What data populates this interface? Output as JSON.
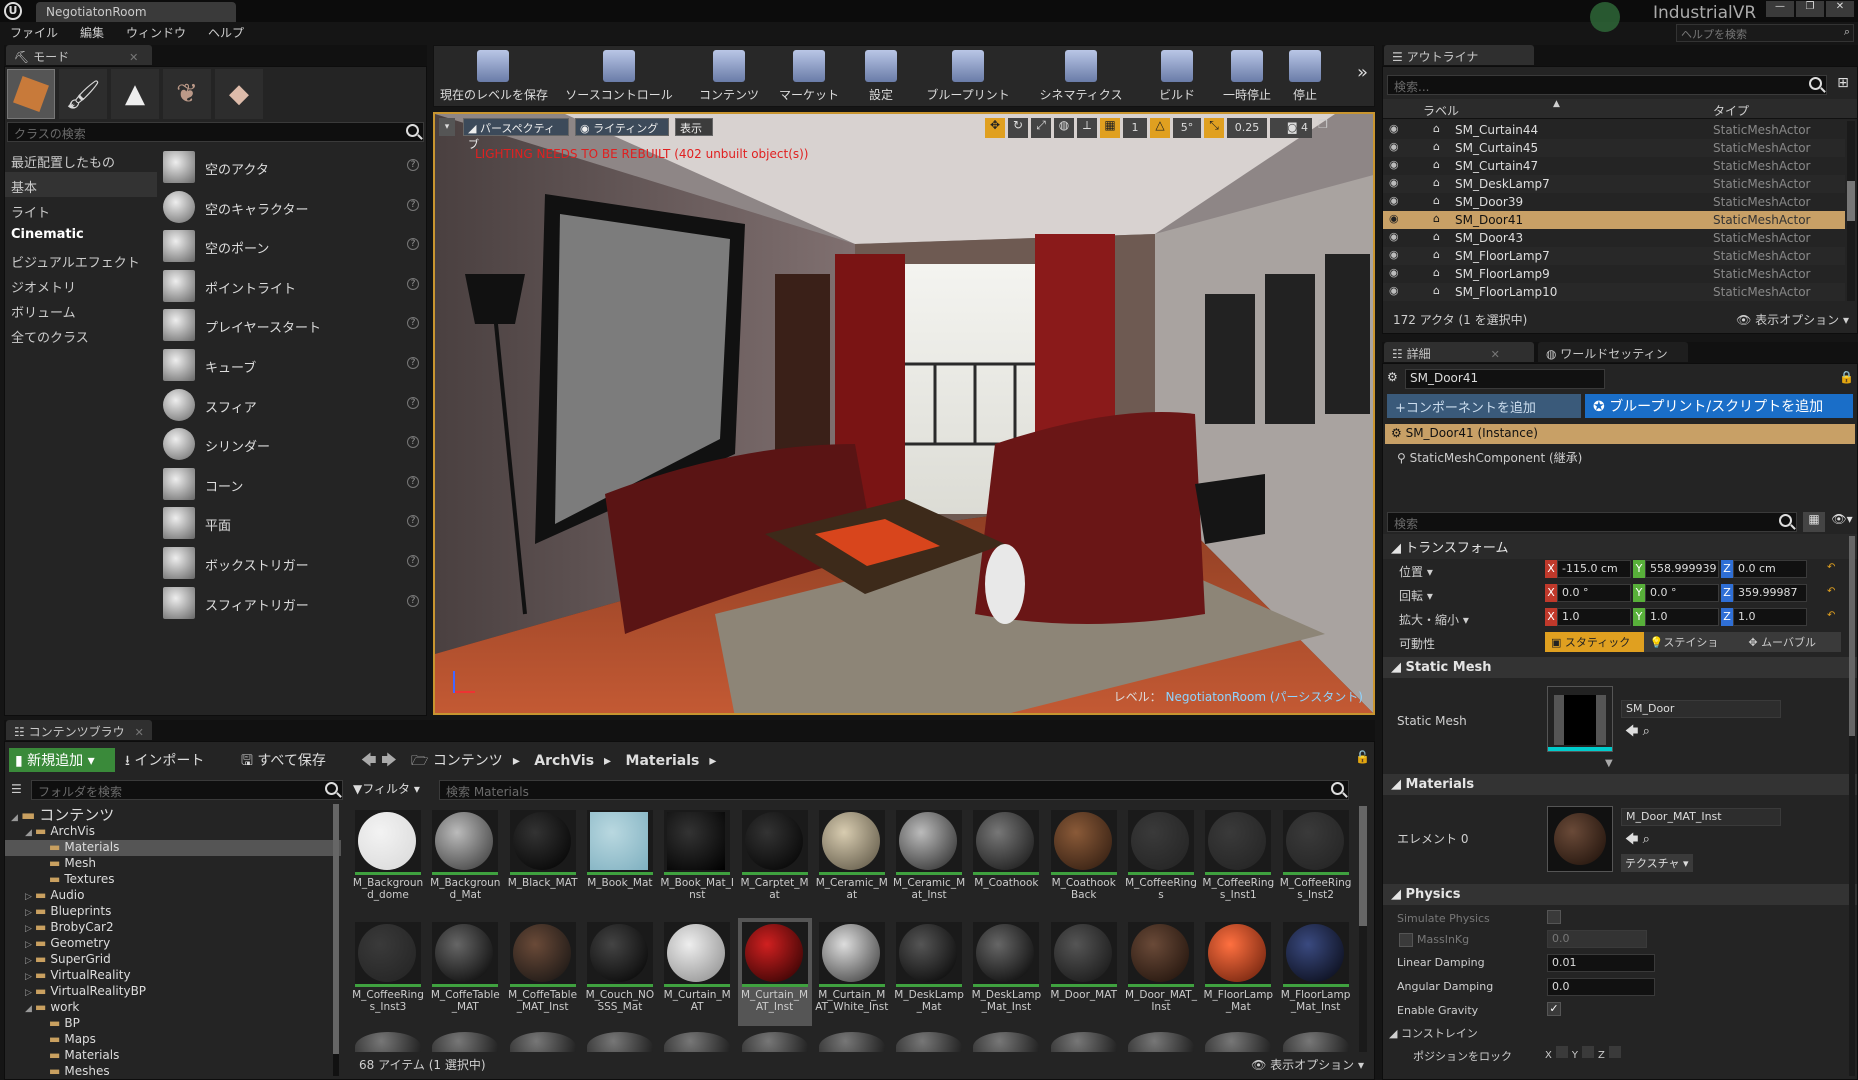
{
  "title_tab": "NegotiatonRoom",
  "menu": [
    "ファイル",
    "編集",
    "ウィンドウ",
    "ヘルプ"
  ],
  "brand": "IndustrialVR",
  "help_search": "ヘルプを検索",
  "modes": {
    "tab": "モード",
    "search_placeholder": "クラスの検索",
    "categories": [
      "最近配置したもの",
      "基本",
      "ライト",
      "Cinematic",
      "ビジュアルエフェクト",
      "ジオメトリ",
      "ボリューム",
      "全てのクラス"
    ],
    "items": [
      "空のアクタ",
      "空のキャラクター",
      "空のポーン",
      "ポイントライト",
      "プレイヤースタート",
      "キューブ",
      "スフィア",
      "シリンダー",
      "コーン",
      "平面",
      "ボックストリガー",
      "スフィアトリガー"
    ]
  },
  "toolbar": [
    "現在のレベルを保存",
    "ソースコントロール",
    "コンテンツ",
    "マーケット",
    "設定",
    "ブループリント",
    "シネマティクス",
    "ビルド",
    "一時停止",
    "停止"
  ],
  "viewport": {
    "perspective": "パースペクティブ",
    "lighting": "ライティング",
    "show": "表示",
    "warning": "LIGHTING NEEDS TO BE REBUILT (402 unbuilt object(s))",
    "level_label": "レベル：",
    "level_name": "NegotiatonRoom (パーシスタント)",
    "grid": "1",
    "angle": "5°",
    "scale": "0.25",
    "speed": "4"
  },
  "outliner": {
    "tab": "アウトライナ",
    "search_placeholder": "検索...",
    "col_label": "ラベル",
    "col_type": "タイプ",
    "rows": [
      {
        "name": "SM_Curtain44",
        "type": "StaticMeshActor"
      },
      {
        "name": "SM_Curtain45",
        "type": "StaticMeshActor"
      },
      {
        "name": "SM_Curtain47",
        "type": "StaticMeshActor"
      },
      {
        "name": "SM_DeskLamp7",
        "type": "StaticMeshActor"
      },
      {
        "name": "SM_Door39",
        "type": "StaticMeshActor"
      },
      {
        "name": "SM_Door41",
        "type": "StaticMeshActor"
      },
      {
        "name": "SM_Door43",
        "type": "StaticMeshActor"
      },
      {
        "name": "SM_FloorLamp7",
        "type": "StaticMeshActor"
      },
      {
        "name": "SM_FloorLamp9",
        "type": "StaticMeshActor"
      },
      {
        "name": "SM_FloorLamp10",
        "type": "StaticMeshActor"
      }
    ],
    "count": "172 アクタ (1 を選択中)",
    "view_options": "表示オプション"
  },
  "details": {
    "tab": "詳細",
    "tab2": "ワールドセッティン",
    "name": "SM_Door41",
    "add_component": "+コンポーネントを追加",
    "blueprint_btn": "ブループリント/スクリプトを追加",
    "instance": "SM_Door41 (Instance)",
    "component": "StaticMeshComponent (継承)",
    "search_placeholder": "検索",
    "transform": "トランスフォーム",
    "location": "位置",
    "rotation": "回転",
    "scale": "拡大・縮小",
    "mobility": "可動性",
    "loc": [
      "-115.0 cm",
      "558.999939",
      "0.0 cm"
    ],
    "rot": [
      "0.0 °",
      "0.0 °",
      "359.99987"
    ],
    "scl": [
      "1.0",
      "1.0",
      "1.0"
    ],
    "mob": [
      "スタティック",
      "ステイショ",
      "ムーバブル"
    ],
    "static_mesh_hdr": "Static Mesh",
    "static_mesh": "Static Mesh",
    "mesh_value": "SM_Door",
    "materials_hdr": "Materials",
    "element": "エレメント 0",
    "material_value": "M_Door_MAT_Inst",
    "texture": "テクスチャ",
    "physics_hdr": "Physics",
    "simulate": "Simulate Physics",
    "mass": "MassInKg",
    "mass_val": "0.0",
    "linear": "Linear Damping",
    "linear_val": "0.01",
    "angular": "Angular Damping",
    "angular_val": "0.0",
    "gravity": "Enable Gravity",
    "constraint": "コンストレイン",
    "lockpos": "ポジションをロック"
  },
  "content": {
    "tab": "コンテンツブラウ",
    "new": "新規追加",
    "import": "インポート",
    "save_all": "すべて保存",
    "path": [
      "コンテンツ",
      "ArchVis",
      "Materials"
    ],
    "folder_search": "フォルダを検索",
    "filter": "フィルタ",
    "search_placeholder": "検索 Materials",
    "status": "68 アイテム (1 選択中)",
    "view_options": "表示オプション",
    "tree": [
      {
        "n": "コンテンツ",
        "l": 0
      },
      {
        "n": "ArchVis",
        "l": 1
      },
      {
        "n": "Materials",
        "l": 2
      },
      {
        "n": "Mesh",
        "l": 2
      },
      {
        "n": "Textures",
        "l": 2
      },
      {
        "n": "Audio",
        "l": 1
      },
      {
        "n": "Blueprints",
        "l": 1
      },
      {
        "n": "BrobyCar2",
        "l": 1
      },
      {
        "n": "Geometry",
        "l": 1
      },
      {
        "n": "SuperGrid",
        "l": 1
      },
      {
        "n": "VirtualReality",
        "l": 1
      },
      {
        "n": "VirtualRealityBP",
        "l": 1
      },
      {
        "n": "work",
        "l": 1
      },
      {
        "n": "BP",
        "l": 2
      },
      {
        "n": "Maps",
        "l": 2
      },
      {
        "n": "Materials",
        "l": 2
      },
      {
        "n": "Meshes",
        "l": 2
      }
    ],
    "assets_row1": [
      "M_Background_dome",
      "M_Background_Mat",
      "M_Black_MAT",
      "M_Book_Mat",
      "M_Book_Mat_Inst",
      "M_Carptet_Mat",
      "M_Ceramic_Mat",
      "M_Ceramic_Mat_Inst",
      "M_Coathook",
      "M_Coathook Back",
      "M_CoffeeRings",
      "M_CoffeeRings_Inst1",
      "M_CoffeeRings_Inst2"
    ],
    "assets_row2": [
      "M_CoffeeRings_Inst3",
      "M_CoffeTable_MAT",
      "M_CoffeTable_MAT_Inst",
      "M_Couch_NOSSS_Mat",
      "M_Curtain_MAT",
      "M_Curtain_MAT_Inst",
      "M_Curtain_MAT_White_Inst",
      "M_DeskLamp_Mat",
      "M_DeskLamp_Mat_Inst",
      "M_Door_MAT",
      "M_Door_MAT_Inst",
      "M_FloorLamp_Mat",
      "M_FloorLamp_Mat_Inst"
    ]
  }
}
